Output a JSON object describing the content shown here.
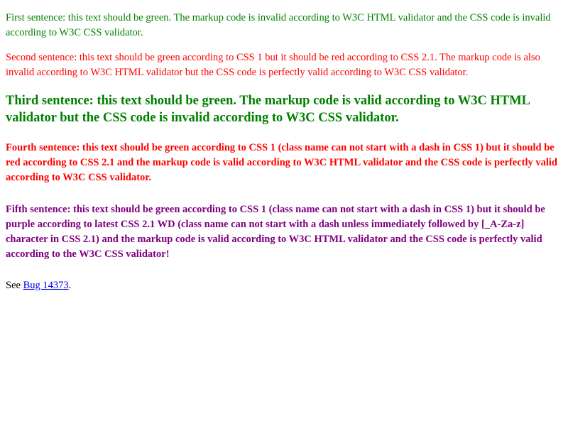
{
  "sentences": [
    {
      "text": "First sentence: this text should be green. The markup code is invalid according to W3C HTML validator and the CSS code is invalid according to W3C CSS validator.",
      "color": "#008000"
    },
    {
      "text": "Second sentence: this text should be green according to CSS 1 but it should be red according to CSS 2.1. The markup code is also invalid according to W3C HTML validator but the CSS code is perfectly valid according to W3C CSS validator.",
      "color": "#ff0000"
    },
    {
      "text": "Third sentence: this text should be green. The markup code is valid according to W3C HTML validator but the CSS code is invalid according to W3C CSS validator.",
      "color": "#008000"
    },
    {
      "text": "Fourth sentence: this text should be green according to CSS 1 (class name can not start with a dash in CSS 1) but it should be red according to CSS 2.1 and the markup code is valid according to W3C HTML validator and the CSS code is perfectly valid according to W3C CSS validator.",
      "color": "#ff0000"
    },
    {
      "text": "Fifth sentence: this text should be green according to CSS 1 (class name can not start with a dash in CSS 1) but it should be purple according to latest CSS 2.1 WD (class name can not start with a dash unless immediately followed by [_A-Za-z] character in CSS 2.1) and the markup code is valid according to W3C HTML validator and the CSS code is perfectly valid according to the W3C CSS validator!",
      "color": "#800080"
    }
  ],
  "footer": {
    "prefix": "See ",
    "link_text": "Bug 14373",
    "suffix": ".",
    "link_color": "#0000ee"
  }
}
